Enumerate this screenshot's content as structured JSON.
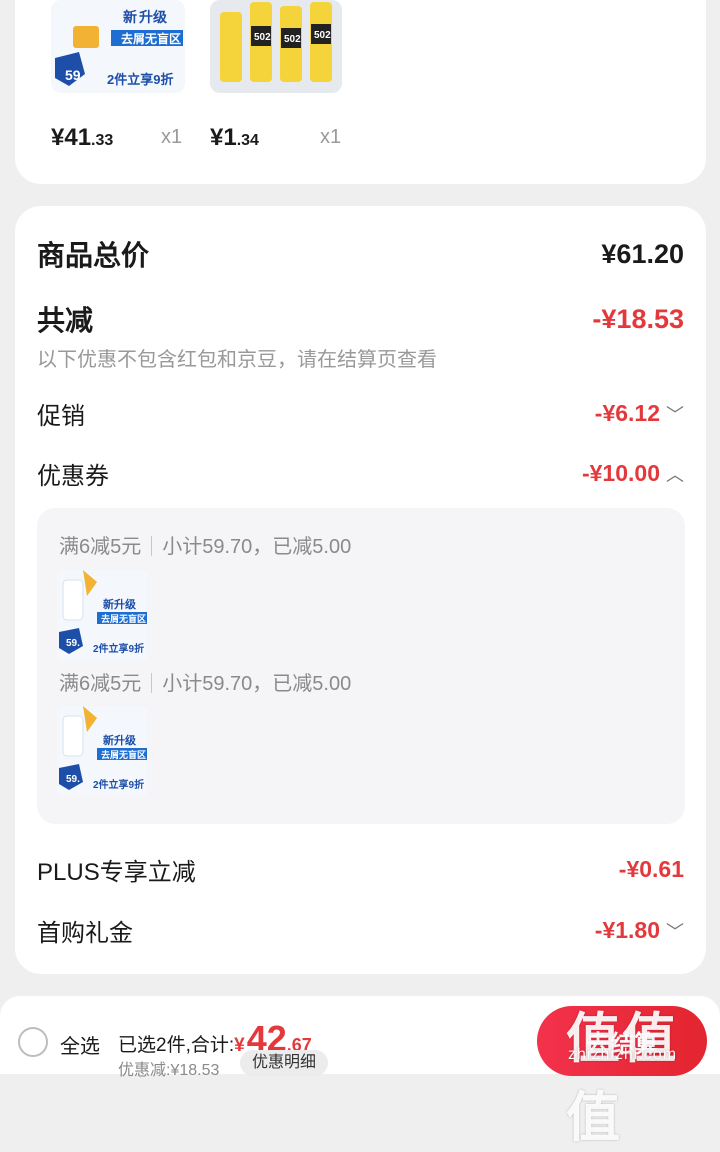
{
  "products": [
    {
      "price_int": "¥41",
      "price_dec": ".33",
      "qty": "x1",
      "img_text_top": "新升级",
      "img_text_mid": "去屑无盲区",
      "img_text_bot": "2件立享9折",
      "img_badge": "59.9"
    },
    {
      "price_int": "¥1",
      "price_dec": ".34",
      "qty": "x1",
      "img_text": "502"
    }
  ],
  "summary": {
    "goods_total_label": "商品总价",
    "goods_total_value": "¥61.20",
    "total_reduction_label": "共减",
    "total_reduction_value": "-¥18.53",
    "note": "以下优惠不包含红包和京豆，请在结算页查看",
    "promo_label": "促销",
    "promo_value": "-¥6.12",
    "coupon_label": "优惠券",
    "coupon_value": "-¥10.00",
    "coupon_entries": [
      {
        "rule": "满6减5元",
        "detail": "小计59.70，已减5.00"
      },
      {
        "rule": "满6减5元",
        "detail": "小计59.70，已减5.00"
      }
    ],
    "plus_label": "PLUS专享立减",
    "plus_value": "-¥0.61",
    "first_gift_label": "首购礼金",
    "first_gift_value": "-¥1.80"
  },
  "bottom_bar": {
    "select_all": "全选",
    "selected_text": "已选2件,合计:",
    "total_yen": "¥",
    "total_int": "42",
    "total_dec": ".67",
    "discount_text": "优惠减:¥18.53",
    "detail_button": "优惠明细",
    "checkout_button": "去结算"
  },
  "watermark": {
    "main": "值值值",
    "sub": "zhizhizhi.com"
  },
  "colors": {
    "accent_red": "#e4393c",
    "background": "#efefef"
  }
}
